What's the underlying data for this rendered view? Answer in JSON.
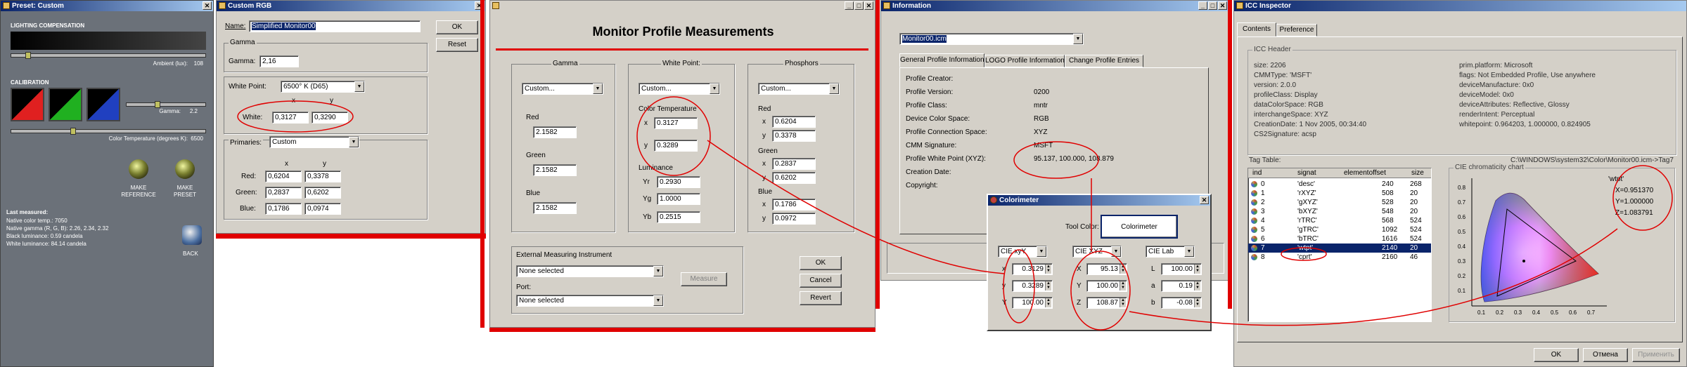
{
  "preset": {
    "title": "Preset: Custom",
    "lighting_header": "LIGHTING COMPENSATION",
    "ambient_label": "Ambient (lux):",
    "ambient_value": "108",
    "calibration_header": "CALIBRATION",
    "gamma_label": "Gamma:",
    "gamma_value": "2.2",
    "colortemp_label": "Color Temperature (degrees K):",
    "colortemp_value": "6500",
    "make_reference": "MAKE REFERENCE",
    "make_preset": "MAKE PRESET",
    "back": "BACK",
    "last_measured": "Last measured:",
    "lines": [
      "Native color temp.: 7050",
      "Native gamma (R, G, B): 2.26, 2.34, 2.32",
      "Black luminance: 0.59 candela",
      "White luminance: 84.14 candela"
    ]
  },
  "customrgb": {
    "title": "Custom RGB",
    "name_label": "Name:",
    "name_value": "Simplified Monitor00",
    "ok": "OK",
    "reset": "Reset",
    "gamma_group": "Gamma",
    "gamma_label": "Gamma:",
    "gamma_value": "2,16",
    "whitepoint_label": "White Point:",
    "whitepoint_value": "6500° K (D65)",
    "col_x": "x",
    "col_y": "y",
    "white_label": "White:",
    "white_x": "0,3127",
    "white_y": "0,3290",
    "primaries_label": "Primaries:",
    "primaries_value": "Custom",
    "red_label": "Red:",
    "red_x": "0,6204",
    "red_y": "0,3378",
    "green_label": "Green:",
    "green_x": "0,2837",
    "green_y": "0,6202",
    "blue_label": "Blue:",
    "blue_x": "0,1786",
    "blue_y": "0,0974"
  },
  "mpm": {
    "title": "Monitor Profile Measurements",
    "gamma_group": "Gamma",
    "gamma_combo": "Custom...",
    "red": "Red",
    "red_v": "2.1582",
    "green": "Green",
    "green_v": "2.1582",
    "blue": "Blue",
    "blue_v": "2.1582",
    "wp_group": "White Point:",
    "wp_combo": "Custom...",
    "ct_label": "Color Temperature",
    "x_label": "x",
    "x_v": "0.3127",
    "y_label": "y",
    "y_v": "0.3289",
    "lum_label": "Luminance",
    "yr_label": "Yr",
    "yr_v": "0.2930",
    "yg_label": "Yg",
    "yg_v": "1.0000",
    "yb_label": "Yb",
    "yb_v": "0.2515",
    "ph_group": "Phosphors",
    "ph_combo": "Custom...",
    "ph_red": "Red",
    "ph_rx": "0.6204",
    "ph_ry": "0.3378",
    "ph_green": "Green",
    "ph_gx": "0.2837",
    "ph_gy": "0.6202",
    "ph_blue": "Blue",
    "ph_bx": "0.1786",
    "ph_by": "0.0972",
    "ext_group": "External Measuring Instrument",
    "ext_combo": "None selected",
    "measure": "Measure",
    "port_label": "Port:",
    "port_combo": "None selected",
    "ok": "OK",
    "cancel": "Cancel",
    "revert": "Revert"
  },
  "info": {
    "title": "Information",
    "file": "Monitor00.icm",
    "tabs": [
      "General Profile Information",
      "LOGO Profile Information",
      "Change Profile Entries"
    ],
    "rows": [
      [
        "Profile Creator:",
        ""
      ],
      [
        "Profile Version:",
        "0200"
      ],
      [
        "Profile Class:",
        "mntr"
      ],
      [
        "Device Color Space:",
        "RGB"
      ],
      [
        "Profile Connection Space:",
        "XYZ"
      ],
      [
        "CMM Signature:",
        "MSFT"
      ],
      [
        "Profile White Point (XYZ):",
        "95.137, 100.000, 108.879"
      ],
      [
        "Creation Date:",
        ""
      ],
      [
        "Copyright:",
        ""
      ]
    ]
  },
  "colorimeter": {
    "title": "Colorimeter",
    "tool_label": "Tool Color:",
    "tool_button": "Colorimeter",
    "c1": "CIE xyY",
    "c2": "CIE XYZ",
    "c3": "CIE Lab",
    "x_l": "x",
    "x_v": "0.3129",
    "y_l": "y",
    "y_v": "0.3289",
    "Y_l": "Y",
    "Y_v": "100.00",
    "X2_l": "X",
    "X2_v": "95.13",
    "Y2_l": "Y",
    "Y2_v": "100.00",
    "Z2_l": "Z",
    "Z2_v": "108.87",
    "L_l": "L",
    "L_v": "100.00",
    "a_l": "a",
    "a_v": "0.19",
    "b_l": "b",
    "b_v": "-0.08"
  },
  "icc": {
    "title": "ICC Inspector",
    "tabs": [
      "Contents",
      "Preference"
    ],
    "header_group": "ICC Header",
    "left": [
      "size: 2206",
      "CMMType: 'MSFT'",
      "version: 2.0.0",
      "profileClass: Display",
      "dataColorSpace: RGB",
      "interchangeSpace: XYZ",
      "CreationDate: 1 Nov 2005, 00:34:40",
      "CS2Signature: acsp"
    ],
    "right": [
      "prim.platform: Microsoft",
      "flags: Not Embedded Profile, Use anywhere",
      "deviceManufacture: 0x0",
      "deviceModel: 0x0",
      "deviceAttributes: Reflective, Glossy",
      "renderIntent: Perceptual",
      "whitepoint: 0.964203, 1.000000, 0.824905"
    ],
    "tagtable_label": "Tag Table:",
    "path": "C:\\WINDOWS\\system32\\Color\\Monitor00.icm->Tag7",
    "cols": [
      "ind",
      "signat",
      "elementoffset",
      "size"
    ],
    "tags": [
      [
        "0",
        "'desc'",
        "240",
        "268"
      ],
      [
        "1",
        "'rXYZ'",
        "508",
        "20"
      ],
      [
        "2",
        "'gXYZ'",
        "528",
        "20"
      ],
      [
        "3",
        "'bXYZ'",
        "548",
        "20"
      ],
      [
        "4",
        "'rTRC'",
        "568",
        "524"
      ],
      [
        "5",
        "'gTRC'",
        "1092",
        "524"
      ],
      [
        "6",
        "'bTRC'",
        "1616",
        "524"
      ],
      [
        "7",
        "'wtpt'",
        "2140",
        "20"
      ],
      [
        "8",
        "'cprt'",
        "2160",
        "46"
      ]
    ],
    "chart_title": "CIE chromaticity chart",
    "wtpt": "'wtpt'",
    "X": "X=0.951370",
    "Y": "Y=1.000000",
    "Z": "Z=1.083791",
    "yticks": [
      "0.8",
      "0.7",
      "0.6",
      "0.5",
      "0.4",
      "0.3",
      "0.2",
      "0.1"
    ],
    "xticks": [
      "0.1",
      "0.2",
      "0.3",
      "0.4",
      "0.5",
      "0.6",
      "0.7"
    ],
    "ok": "OK",
    "cancel": "Отмена",
    "apply": "Применить"
  }
}
